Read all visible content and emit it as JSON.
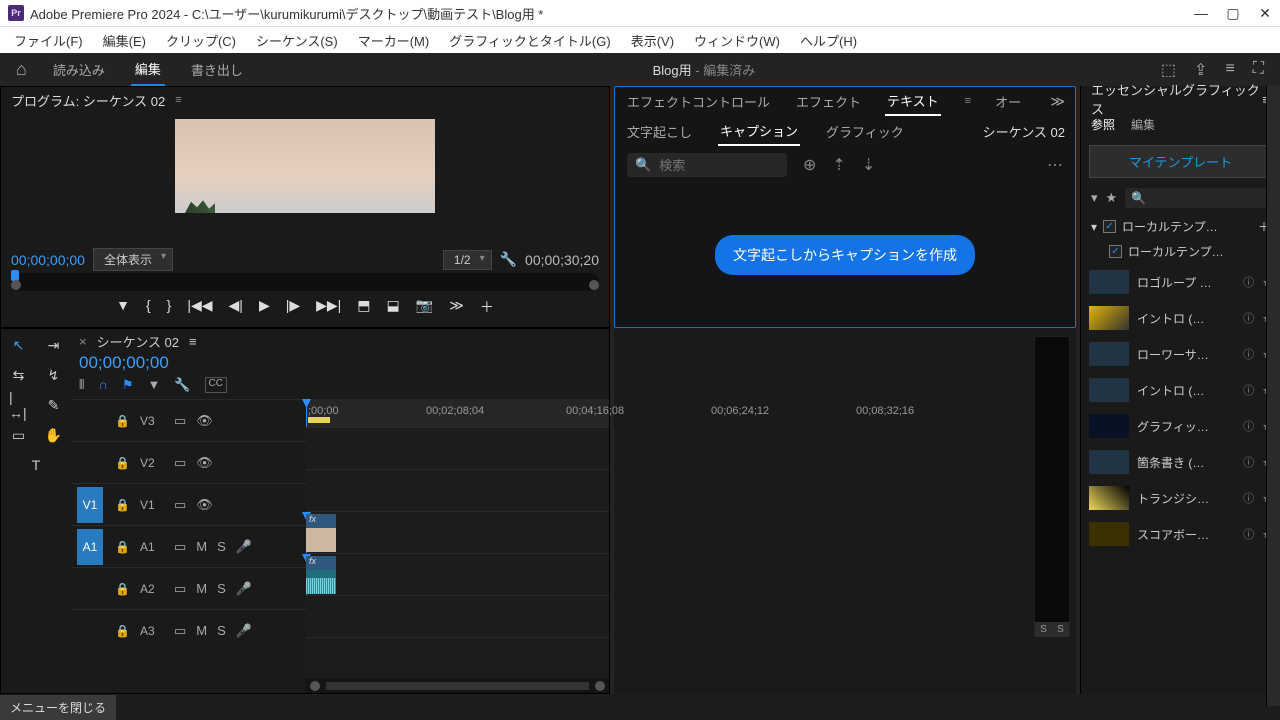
{
  "title": "Adobe Premiere Pro 2024 - C:\\ユーザー\\kurumikurumi\\デスクトップ\\動画テスト\\Blog用 *",
  "menus": [
    "ファイル(F)",
    "編集(E)",
    "クリップ(C)",
    "シーケンス(S)",
    "マーカー(M)",
    "グラフィックとタイトル(G)",
    "表示(V)",
    "ウィンドウ(W)",
    "ヘルプ(H)"
  ],
  "workspace": {
    "items": [
      "読み込み",
      "編集",
      "書き出し"
    ],
    "active": 1,
    "project": "Blog用",
    "state": "編集済み"
  },
  "program": {
    "title": "プログラム: シーケンス 02",
    "tc": "00;00;00;00",
    "fit": "全体表示",
    "res": "1/2",
    "duration": "00;00;30;20"
  },
  "textpanel": {
    "tabs": [
      "エフェクトコントロール",
      "エフェクト",
      "テキスト",
      "オー"
    ],
    "active": 2,
    "subtabs": [
      "文字起こし",
      "キャプション",
      "グラフィック"
    ],
    "subactive": 1,
    "sequence": "シーケンス 02",
    "search_ph": "検索",
    "button": "文字起こしからキャプションを作成"
  },
  "timeline": {
    "name": "シーケンス 02",
    "tc": "00;00;00;00",
    "ticks": [
      ";00;00",
      "00;02;08;04",
      "00;04;16;08",
      "00;06;24;12",
      "00;08;32;16"
    ],
    "tracks": {
      "v": [
        "V3",
        "V2",
        "V1"
      ],
      "a": [
        "A1",
        "A2",
        "A3"
      ]
    },
    "source": {
      "v": "V1",
      "a": "A1"
    }
  },
  "eg": {
    "title": "エッセンシャルグラフィックス",
    "tabs": [
      "参照",
      "編集"
    ],
    "active": 0,
    "btn": "マイテンプレート",
    "local": "ローカルテンプ…",
    "local2": "ローカルテンプ…",
    "items": [
      "ロゴループ …",
      "イントロ (…",
      "ローワーサ…",
      "イントロ (…",
      "グラフィッ…",
      "箇条書き (…",
      "トランジシ…",
      "スコアボー…"
    ]
  },
  "status": "メニューを閉じる",
  "vu": {
    "s": "S"
  }
}
